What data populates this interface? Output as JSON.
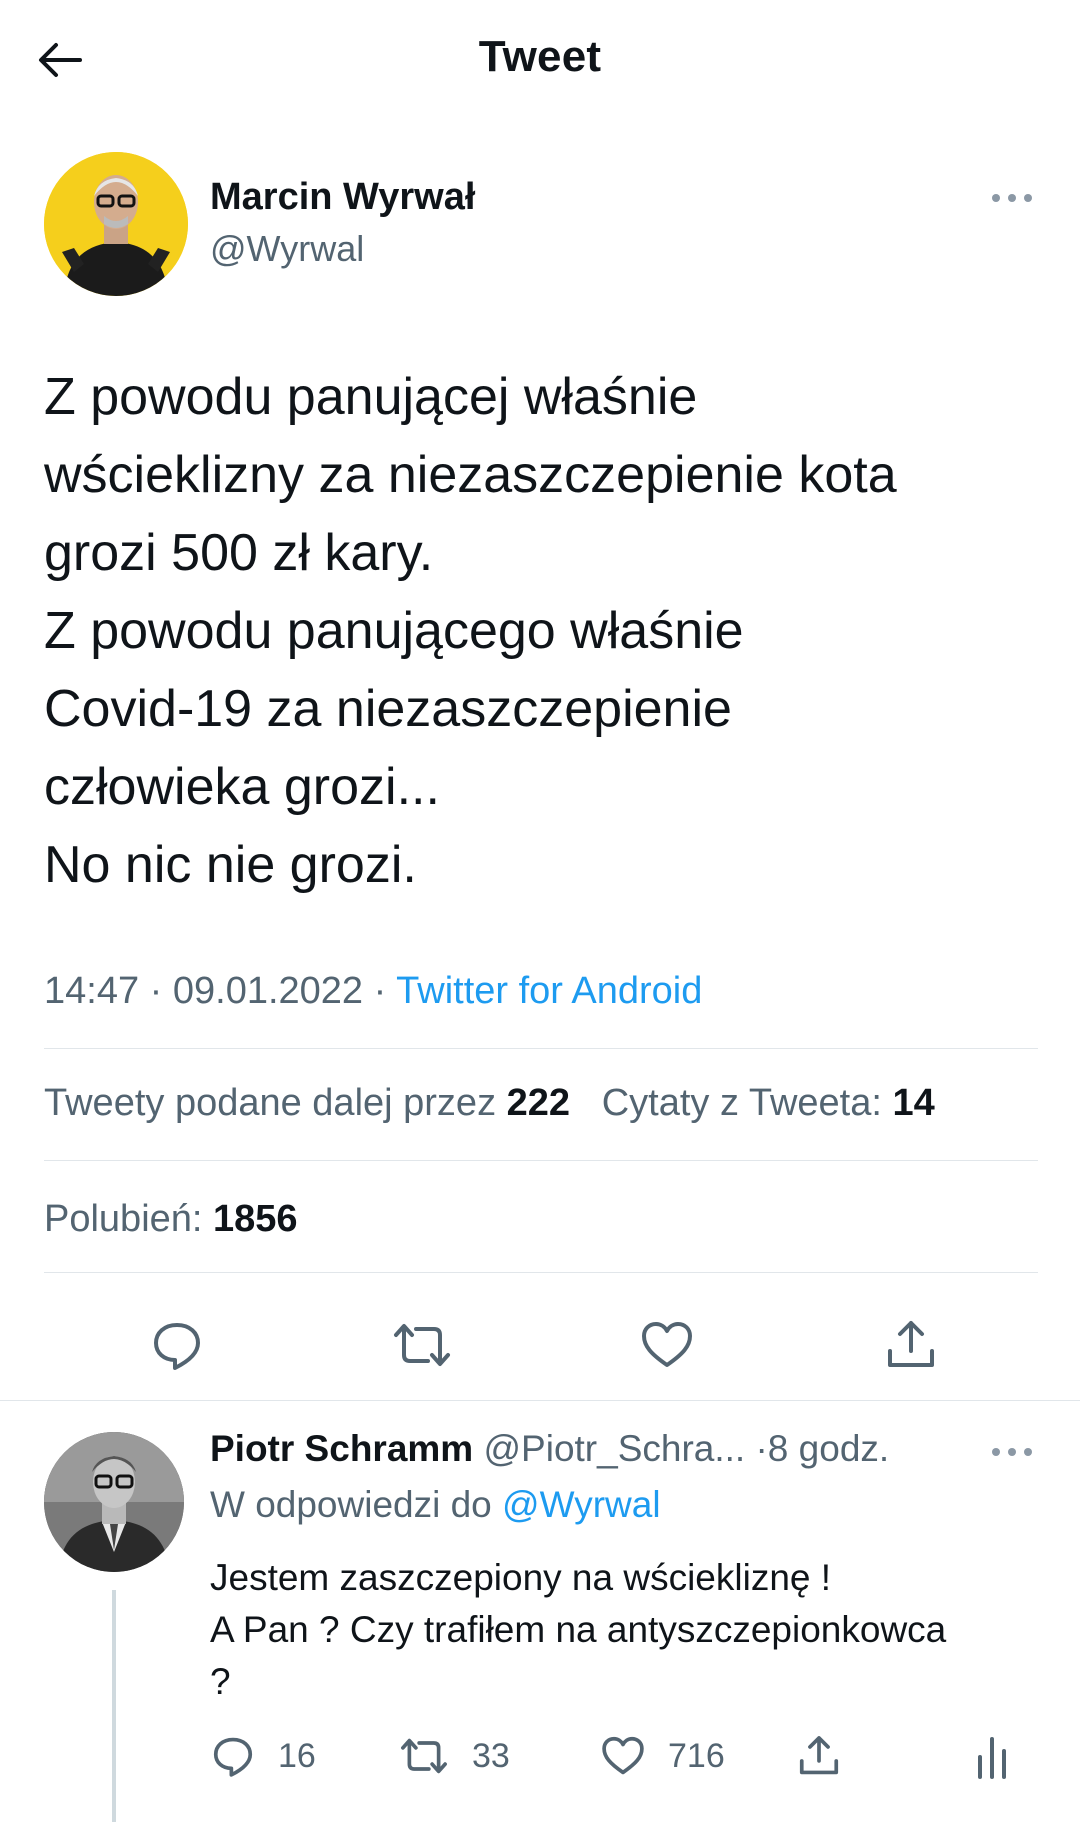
{
  "header": {
    "title": "Tweet",
    "back_icon": "arrow-left-icon"
  },
  "tweet": {
    "author_name": "Marcin Wyrwał",
    "author_handle": "@Wyrwal",
    "lines": [
      "Z powodu panującej właśnie",
      "wścieklizny za niezaszczepienie kota",
      "grozi 500 zł kary.",
      "Z powodu panującego właśnie",
      "Covid-19 za niezaszczepienie",
      "człowieka grozi...",
      "No nic nie grozi."
    ],
    "time": "14:47 · 09.01.2022 · ",
    "source": "Twitter for Android",
    "retweets_label": "Tweety podane dalej przez ",
    "retweets_count": "222",
    "quotes_label": "Cytaty z Tweeta: ",
    "quotes_count": "14",
    "likes_label": "Polubień: ",
    "likes_count": "1856"
  },
  "reply": {
    "name": "Piotr Schramm",
    "handle": "@Piotr_Schra...",
    "time": "·8 godz.",
    "replying_label": "W odpowiedzi do ",
    "replying_handle": "@Wyrwal",
    "lines": [
      "Jestem zaszczepiony na wściekliznę !",
      "A Pan ? Czy trafiłem na antyszczepionkowca",
      "?"
    ],
    "reply_count": "16",
    "retweet_count": "33",
    "like_count": "716"
  },
  "colors": {
    "accent": "#1d9bf0",
    "secondary_text": "#536471",
    "avatar_bg": "#f5cf1c"
  },
  "icons": [
    "arrow-left-icon",
    "more-icon",
    "reply-icon",
    "retweet-icon",
    "like-icon",
    "share-icon",
    "analytics-icon"
  ]
}
